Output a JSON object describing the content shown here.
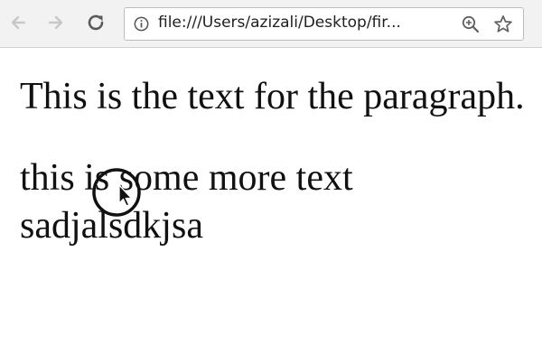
{
  "toolbar": {
    "url": "file:///Users/azizali/Desktop/fir..."
  },
  "icons": {
    "back": "arrow-left-icon",
    "forward": "arrow-right-icon",
    "reload": "reload-icon",
    "info": "info-icon",
    "zoom": "zoom-icon",
    "bookmark": "star-icon",
    "cursor": "mouse-pointer-icon"
  },
  "page": {
    "paragraphs": [
      "This is the text for the paragraph.",
      "this is some more text sadjalsdkjsa"
    ]
  }
}
